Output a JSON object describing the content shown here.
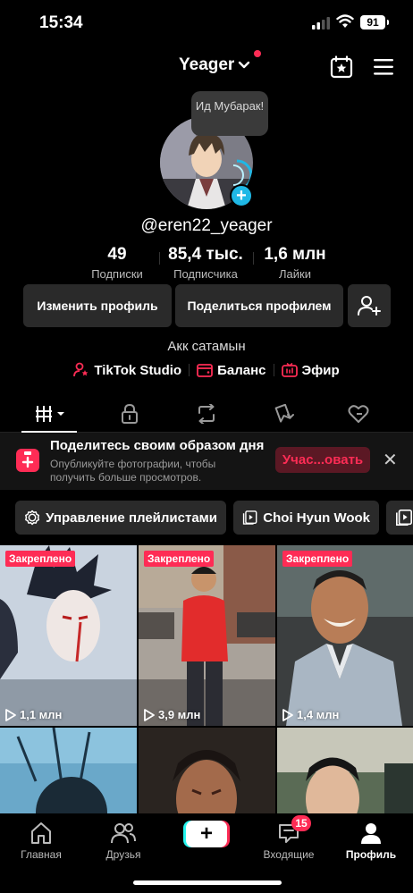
{
  "status": {
    "time": "15:34",
    "battery": "91"
  },
  "header": {
    "username": "Yeager"
  },
  "profile": {
    "bubble": "Ид Мубарак!",
    "handle": "@eren22_yeager",
    "stats": [
      {
        "value": "49",
        "label": "Подписки"
      },
      {
        "value": "85,4 тыс.",
        "label": "Подписчика"
      },
      {
        "value": "1,6 млн",
        "label": "Лайки"
      }
    ],
    "edit_label": "Изменить профиль",
    "share_label": "Поделиться профилем",
    "bio": "Акк сатамын",
    "links": [
      "TikTok Studio",
      "Баланс",
      "Эфир"
    ]
  },
  "promo": {
    "title": "Поделитесь своим образом дня",
    "subtitle": "Опубликуйте фотографии, чтобы получить больше просмотров.",
    "button": "Учас...овать"
  },
  "playlists": [
    "Управление плейлистами",
    "Choi Hyun Wook"
  ],
  "videos": [
    {
      "pinned": "Закреплено",
      "views": "1,1 млн"
    },
    {
      "pinned": "Закреплено",
      "views": "3,9 млн"
    },
    {
      "pinned": "Закреплено",
      "views": "1,4 млн"
    }
  ],
  "nav": {
    "home": "Главная",
    "friends": "Друзья",
    "inbox": "Входящие",
    "inbox_badge": "15",
    "profile": "Профиль"
  },
  "colors": {
    "accent": "#fe2c55",
    "cyan": "#25f4ee"
  }
}
